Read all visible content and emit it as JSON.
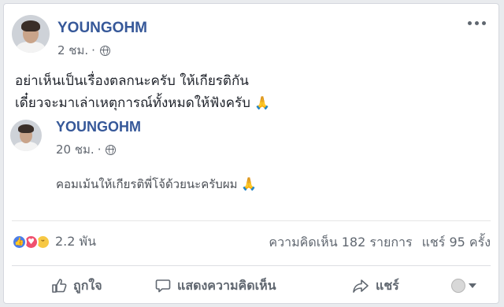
{
  "post": {
    "author": "YOUNGOHM",
    "time": "2 ชม.",
    "privacy_icon": "globe-icon",
    "text_line1": "อย่าเห็นเป็นเรื่องตลกนะครับ ให้เกียรติกัน",
    "text_line2": "เดี๋ยวจะมาเล่าเหตุการณ์ทั้งหมดให้ฟังครับ",
    "emoji": "🙏"
  },
  "comment": {
    "author": "YOUNGOHM",
    "time": "20 ชม.",
    "privacy_icon": "globe-icon",
    "text": "คอมเม้นให้เกียรติพี่โจ้ด้วยนะครับผม",
    "emoji": "🙏"
  },
  "reactions": {
    "types": [
      "like",
      "love",
      "haha"
    ],
    "count": "2.2 พัน"
  },
  "stats": {
    "comments": "ความคิดเห็น 182 รายการ",
    "shares": "แชร์ 95 ครั้ง"
  },
  "actions": {
    "like": "ถูกใจ",
    "comment": "แสดงความคิดเห็น",
    "share": "แชร์"
  },
  "colors": {
    "link": "#365899",
    "text": "#1d2129",
    "meta": "#616770",
    "like": "#4b7ee8",
    "love": "#f0506e",
    "haha": "#f7c844"
  }
}
